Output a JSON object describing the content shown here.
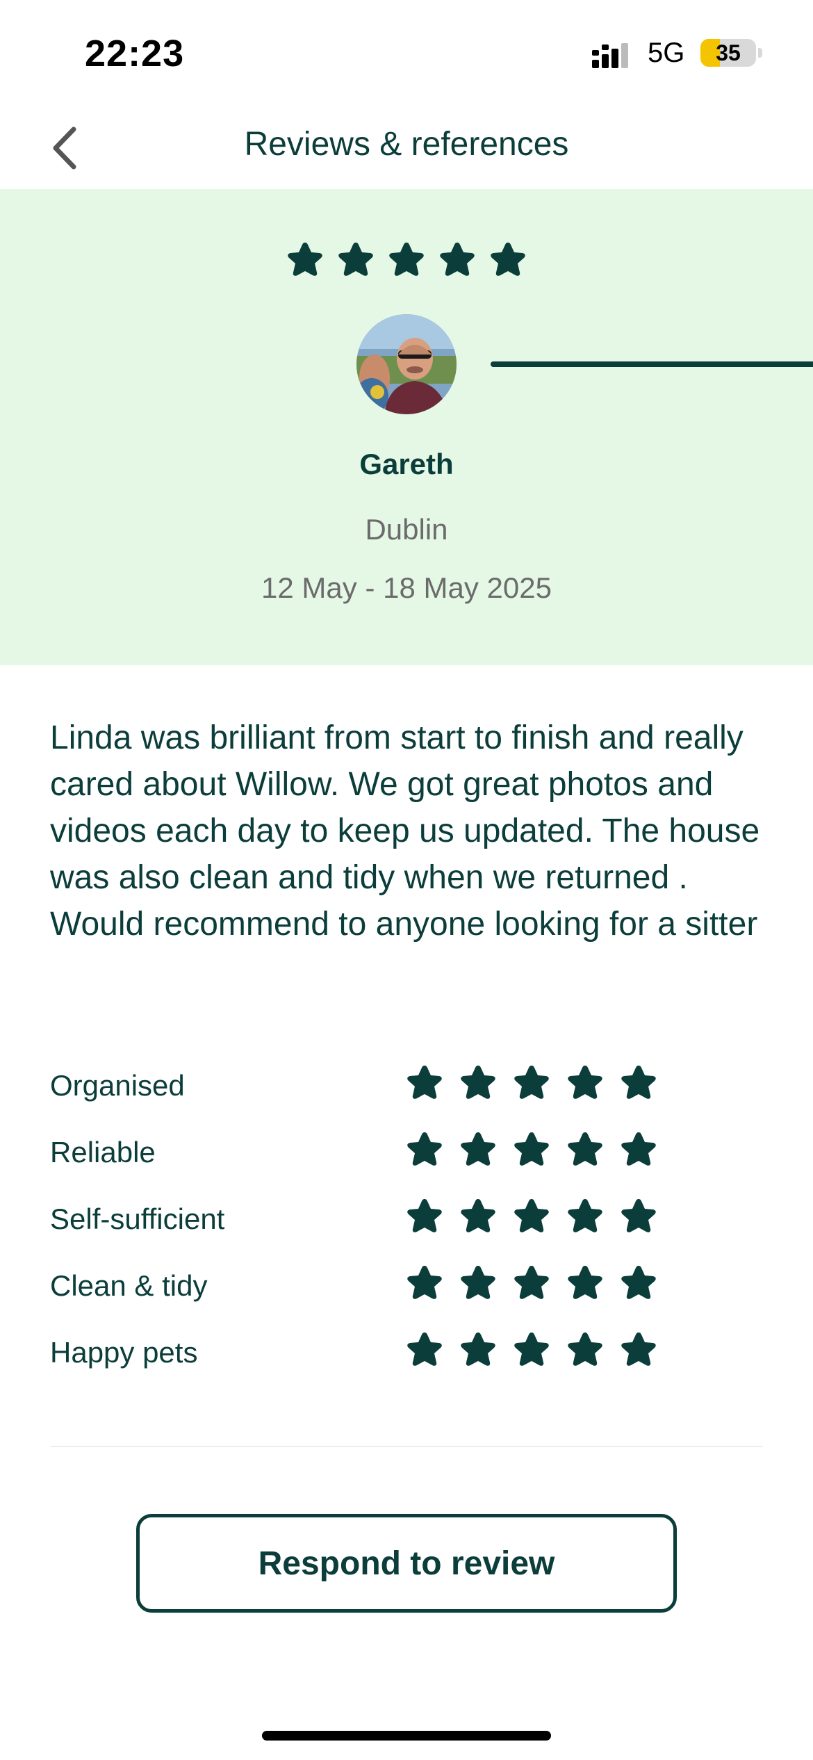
{
  "status_bar": {
    "time": "22:23",
    "network": "5G",
    "battery_level": 35,
    "battery_text": "35",
    "battery_color": "#f5c400",
    "signal_icon": "cellular-signal-icon"
  },
  "header": {
    "title": "Reviews & references",
    "back_icon": "chevron-left-icon"
  },
  "hero": {
    "overall_rating": 5,
    "rating_max": 5,
    "reviewer_name": "Gareth",
    "reviewer_location": "Dublin",
    "dates": "12 May - 18 May 2025",
    "background_color": "#e5f8e6",
    "avatar_icon": "avatar-photo"
  },
  "review": {
    "text": "Linda was brilliant from start to finish and really cared about Willow. We got great photos and videos each day to keep us updated. The house was also clean and tidy when we returned . Would recommend to anyone looking for a sitter"
  },
  "ratings": [
    {
      "label": "Organised",
      "stars": 5
    },
    {
      "label": "Reliable",
      "stars": 5
    },
    {
      "label": "Self-sufficient",
      "stars": 5
    },
    {
      "label": "Clean & tidy",
      "stars": 5
    },
    {
      "label": "Happy pets",
      "stars": 5
    }
  ],
  "actions": {
    "respond_label": "Respond to review"
  },
  "colors": {
    "primary": "#0b3d3a",
    "muted_text": "#6b6b6b"
  }
}
